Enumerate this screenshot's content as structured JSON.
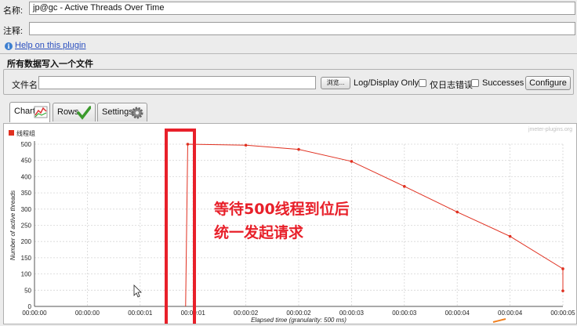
{
  "form": {
    "name_label": "名称:",
    "name_value": "jp@gc - Active Threads Over Time",
    "comment_label": "注释:",
    "comment_value": "",
    "help_link": "Help on this plugin"
  },
  "file_section": {
    "title": "所有数据写入一个文件",
    "filename_label": "文件名",
    "filename_value": "",
    "browse_label": "浏览...",
    "log_display_label": "Log/Display Only:",
    "errors_only_label": "仅日志错误",
    "successes_label": "Successes",
    "configure_label": "Configure"
  },
  "tabs": [
    {
      "label": "Chart",
      "icon": "chart-icon",
      "active": true
    },
    {
      "label": "Rows",
      "icon": "checkmark-icon",
      "active": false
    },
    {
      "label": "Settings",
      "icon": "gear-icon",
      "active": false
    }
  ],
  "watermark": "jmeter-plugins.org",
  "annotation": {
    "line1": "等待500线程到位后",
    "line2": "统一发起请求",
    "color": "#e8202a"
  },
  "colors": {
    "series": "#e03020",
    "annotation": "#e8202a",
    "link": "#2a4fbf"
  },
  "chart_data": {
    "type": "line",
    "title": "",
    "xlabel": "Elapsed time (granularity: 500 ms)",
    "ylabel": "Number of active threads",
    "ylim": [
      0,
      500
    ],
    "yticks": [
      0,
      50,
      100,
      150,
      200,
      250,
      300,
      350,
      400,
      450,
      500
    ],
    "xtick_labels": [
      "00:00:00",
      "00:00:00",
      "00:00:01",
      "00:00:01",
      "00:00:02",
      "00:00:02",
      "00:00:03",
      "00:00:03",
      "00:00:04",
      "00:00:04",
      "00:00:05"
    ],
    "legend": "top-left",
    "grid": true,
    "series": [
      {
        "name": "线程组",
        "x": [
          1.43,
          1.45,
          2.0,
          2.5,
          3.0,
          3.5,
          4.0,
          4.5,
          5.0,
          5.0
        ],
        "values": [
          0,
          500,
          497,
          484,
          447,
          370,
          291,
          216,
          116,
          48
        ]
      }
    ]
  }
}
